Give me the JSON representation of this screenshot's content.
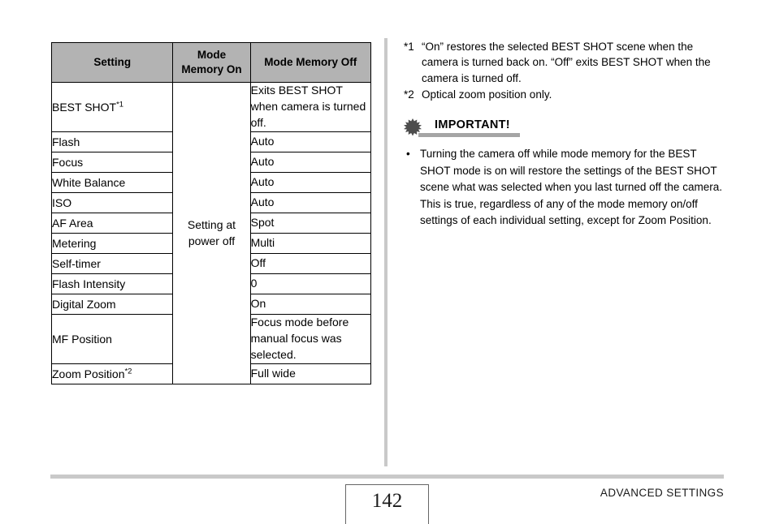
{
  "table": {
    "headers": [
      "Setting",
      "Mode\nMemory On",
      "Mode Memory Off"
    ],
    "header_setting": "Setting",
    "header_mode_memory_on_line1": "Mode",
    "header_mode_memory_on_line2": "Memory On",
    "header_mode_memory_off": "Mode Memory Off",
    "mode_memory_on_merged_line1": "Setting at",
    "mode_memory_on_merged_line2": "power off",
    "rows": [
      {
        "setting": "BEST SHOT",
        "setting_sup": "*1",
        "off": "Exits BEST SHOT when camera is turned off."
      },
      {
        "setting": "Flash",
        "setting_sup": "",
        "off": "Auto"
      },
      {
        "setting": "Focus",
        "setting_sup": "",
        "off": "Auto"
      },
      {
        "setting": "White Balance",
        "setting_sup": "",
        "off": "Auto"
      },
      {
        "setting": "ISO",
        "setting_sup": "",
        "off": "Auto"
      },
      {
        "setting": "AF Area",
        "setting_sup": "",
        "off": "Spot"
      },
      {
        "setting": "Metering",
        "setting_sup": "",
        "off": "Multi"
      },
      {
        "setting": "Self-timer",
        "setting_sup": "",
        "off": "Off"
      },
      {
        "setting": "Flash Intensity",
        "setting_sup": "",
        "off": "0"
      },
      {
        "setting": "Digital Zoom",
        "setting_sup": "",
        "off": "On"
      },
      {
        "setting": "MF Position",
        "setting_sup": "",
        "off": "Focus mode before manual focus was selected."
      },
      {
        "setting": "Zoom Position",
        "setting_sup": "*2",
        "off": "Full wide"
      }
    ]
  },
  "footnotes": [
    {
      "label": "*1",
      "text": "“On” restores the selected BEST SHOT scene when the camera is turned back on. “Off” exits BEST SHOT when the camera is turned off."
    },
    {
      "label": "*2",
      "text": "Optical zoom position only."
    }
  ],
  "important": {
    "title": "IMPORTANT!",
    "bullets": [
      {
        "dot": "•",
        "text": "Turning the camera off while mode memory for the BEST SHOT mode is on will restore the settings of the BEST SHOT scene what was selected when you last turned off the camera. This is true, regardless of any of the mode memory on/off settings of each individual setting, except for Zoom Position."
      }
    ]
  },
  "footer": {
    "page_number": "142",
    "section": "ADVANCED SETTINGS"
  },
  "colors": {
    "header_fill": "#b3b3b3",
    "divider": "#c9c9c9",
    "rule": "#c9c9c9",
    "important_underline": "#a5a5a5",
    "starburst": "#4d4d4d"
  }
}
